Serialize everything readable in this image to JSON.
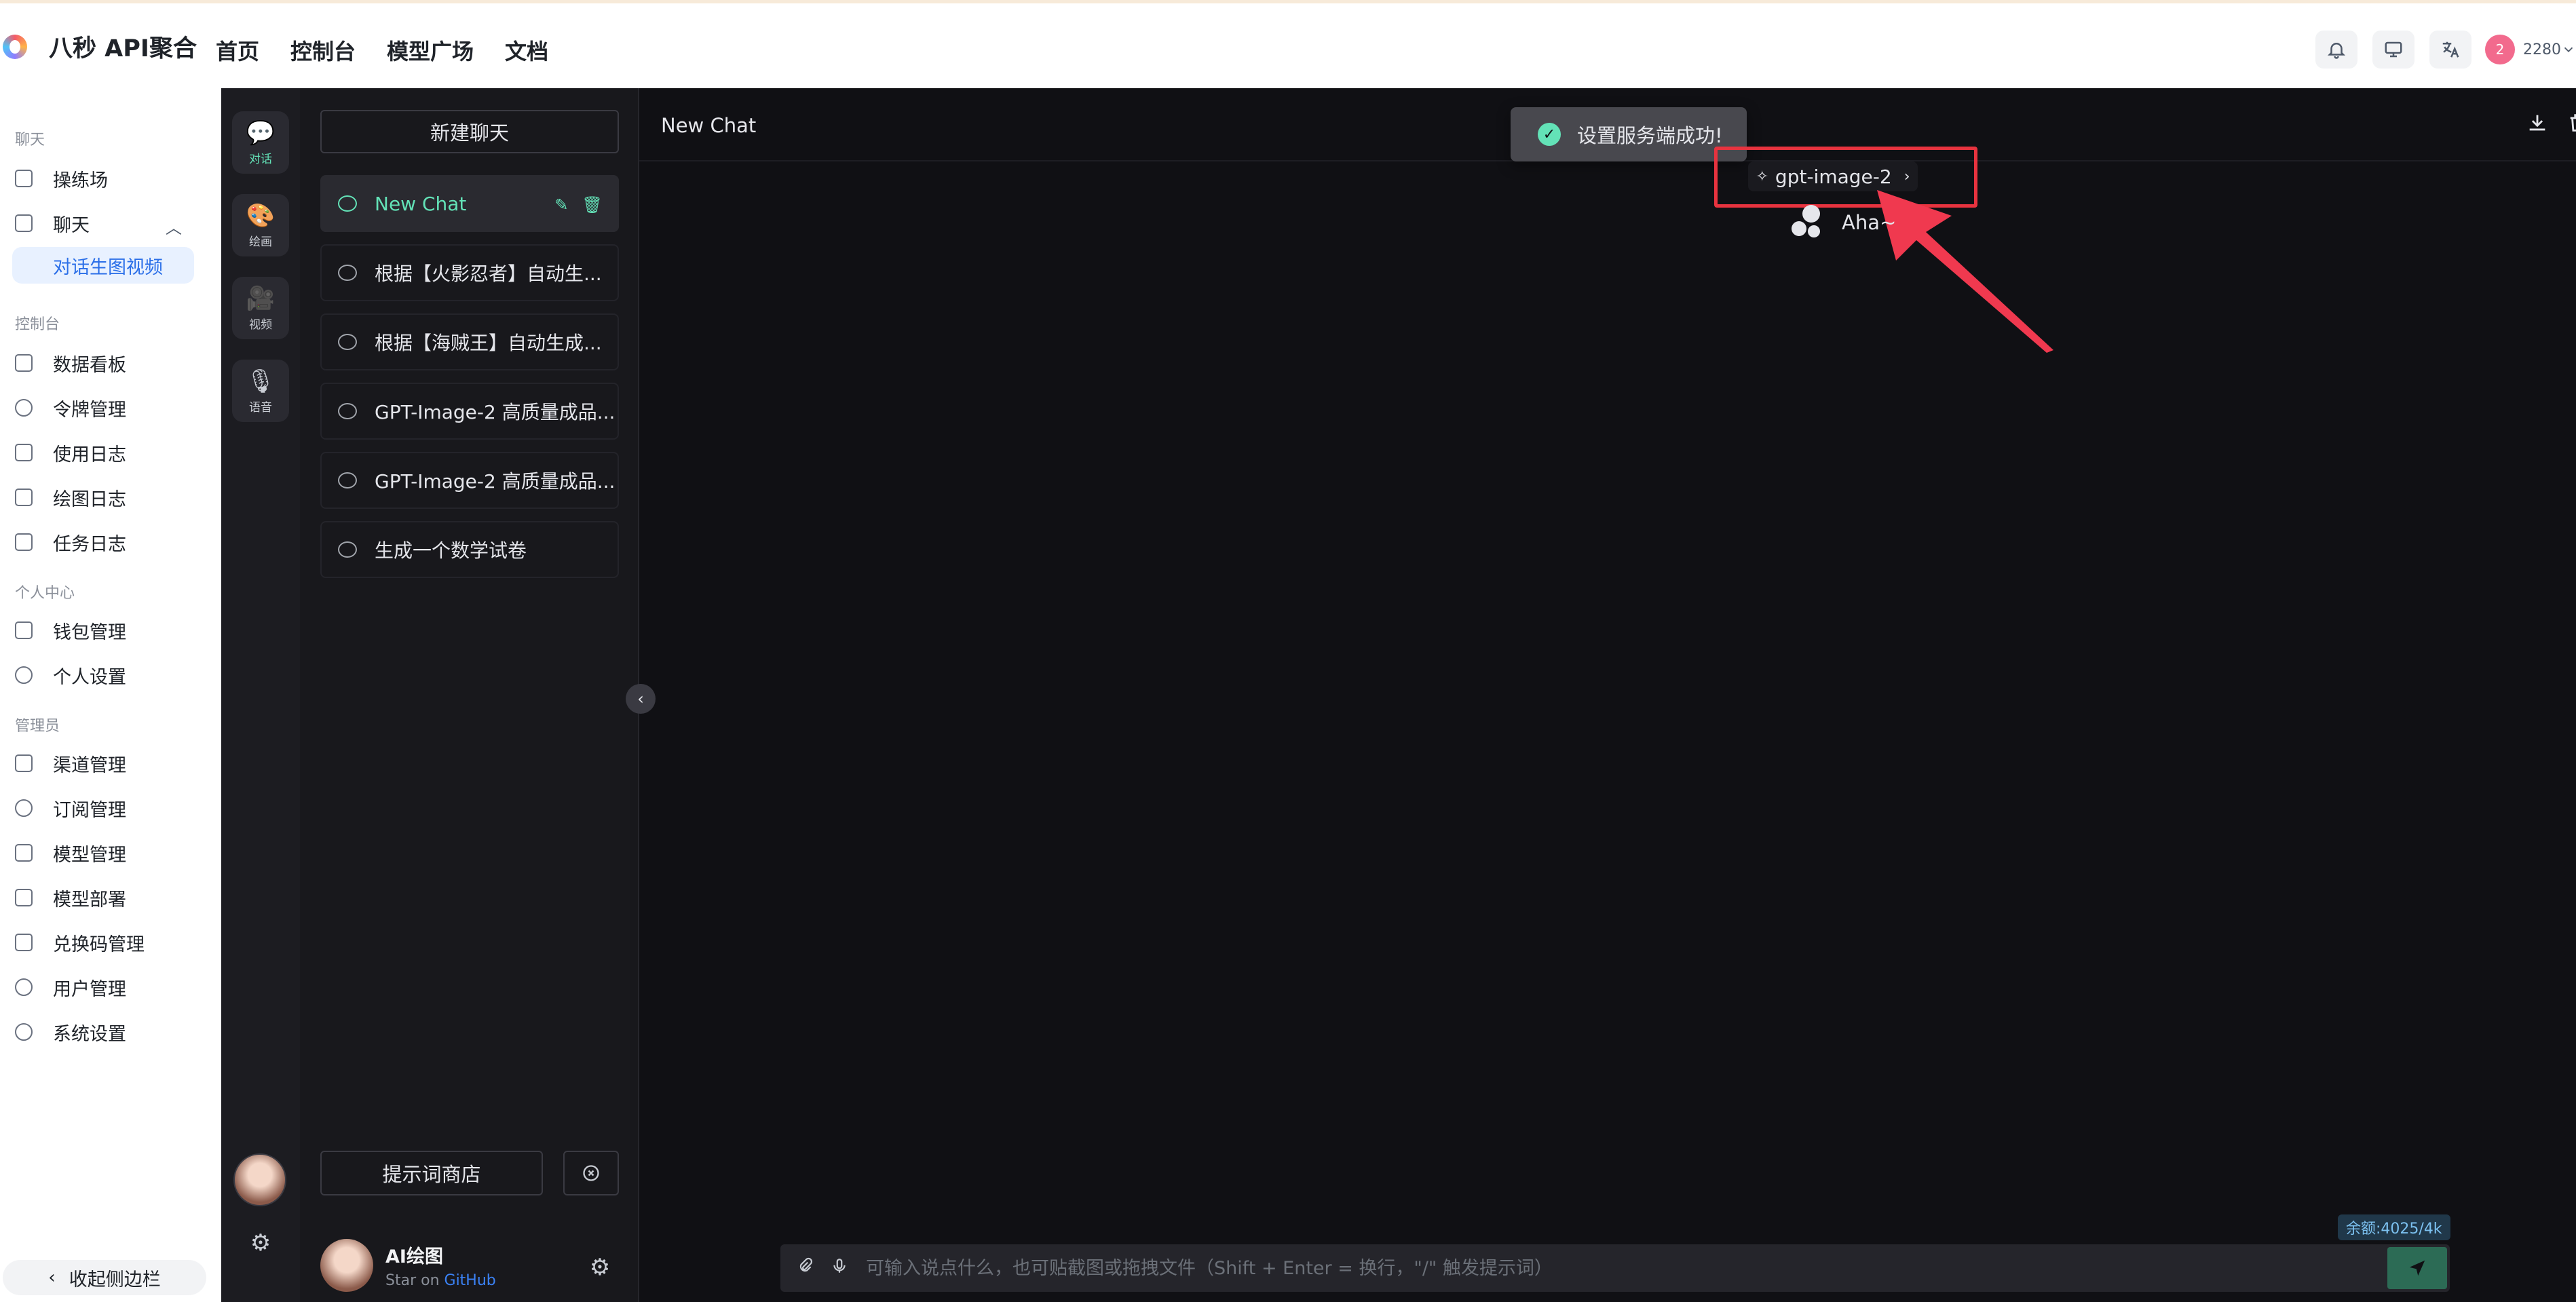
{
  "app": {
    "brand_name": "八秒 API聚合",
    "top_nav": [
      "首页",
      "控制台",
      "模型广场",
      "文档"
    ],
    "user_badge": "2",
    "user_balance": "2280"
  },
  "sidebar": {
    "groups": {
      "chat": "聊天",
      "console": "控制台",
      "personal": "个人中心",
      "admin": "管理员"
    },
    "items": {
      "playground": "操练场",
      "chat": "聊天",
      "chat_sub_active": "对话生图视频",
      "dashboard": "数据看板",
      "tokens": "令牌管理",
      "usage_log": "使用日志",
      "draw_log": "绘图日志",
      "task_log": "任务日志",
      "wallet": "钱包管理",
      "profile": "个人设置",
      "channels": "渠道管理",
      "subscriptions": "订阅管理",
      "models": "模型管理",
      "deploy": "模型部署",
      "redeem": "兑换码管理",
      "users": "用户管理",
      "settings": "系统设置"
    },
    "collapse_label": "收起侧边栏"
  },
  "rail": {
    "chat": "对话",
    "draw": "绘画",
    "video": "视频",
    "voice": "语音"
  },
  "panel": {
    "new_chat": "新建聊天",
    "conversations": [
      "New Chat",
      "根据【火影忍者】自动生...",
      "根据【海贼王】自动生成...",
      "GPT-Image-2 高质量成品...",
      "GPT-Image-2 高质量成品...",
      "生成一个数学试卷"
    ],
    "prompt_store": "提示词商店",
    "user_name": "AI绘图",
    "user_sub_prefix": "Star on",
    "user_sub_link": "GitHub"
  },
  "chat": {
    "title": "New Chat",
    "toast": "设置服务端成功!",
    "model": "gpt-image-2",
    "assistant_message": "Aha~",
    "token_badge": "余额:4025/4k",
    "input_placeholder": "可输入说点什么，也可贴截图或拖拽文件（Shift + Enter = 换行，\"/\" 触发提示词）"
  },
  "colors": {
    "accent": "#63e2b7",
    "annotation": "#e8333f",
    "dark_bg": "#101014",
    "link": "#3b82f6"
  }
}
